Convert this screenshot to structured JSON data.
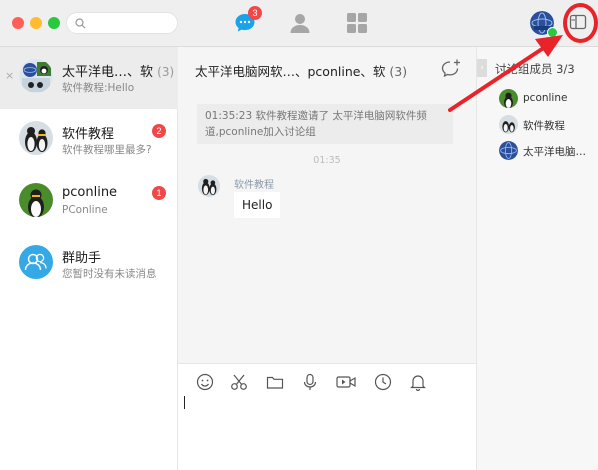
{
  "toolbar": {
    "chat_badge": "3",
    "colors": {
      "accent": "#1aa3e8",
      "badge": "#f04848",
      "online": "#28c840",
      "annotation": "#e8242a"
    }
  },
  "sidebar": {
    "conversations": [
      {
        "name": "太平洋电…、软",
        "count": "(3)",
        "subtitle": "软件教程:Hello",
        "badge": "",
        "active": true,
        "close": "×"
      },
      {
        "name": "软件教程",
        "count": "",
        "subtitle": "软件教程哪里最多?",
        "badge": "2",
        "active": false
      },
      {
        "name": "pconline",
        "count": "",
        "subtitle": "PConline",
        "badge": "1",
        "active": false
      },
      {
        "name": "群助手",
        "count": "",
        "subtitle": "您暂时没有未读消息",
        "badge": "",
        "active": false
      }
    ]
  },
  "chat": {
    "title": "太平洋电脑网软…、pconline、软",
    "member_count": "(3)",
    "system_message": "01:35:23 软件教程邀请了 太平洋电脑网软件频道,pconline加入讨论组",
    "timestamp": "01:35",
    "messages": [
      {
        "sender": "软件教程",
        "text": "Hello"
      }
    ]
  },
  "members_panel": {
    "header": "讨论组成员 3/3",
    "collapse_glyph": "›",
    "members": [
      {
        "name": "pconline"
      },
      {
        "name": "软件教程"
      },
      {
        "name": "太平洋电脑…"
      }
    ]
  }
}
